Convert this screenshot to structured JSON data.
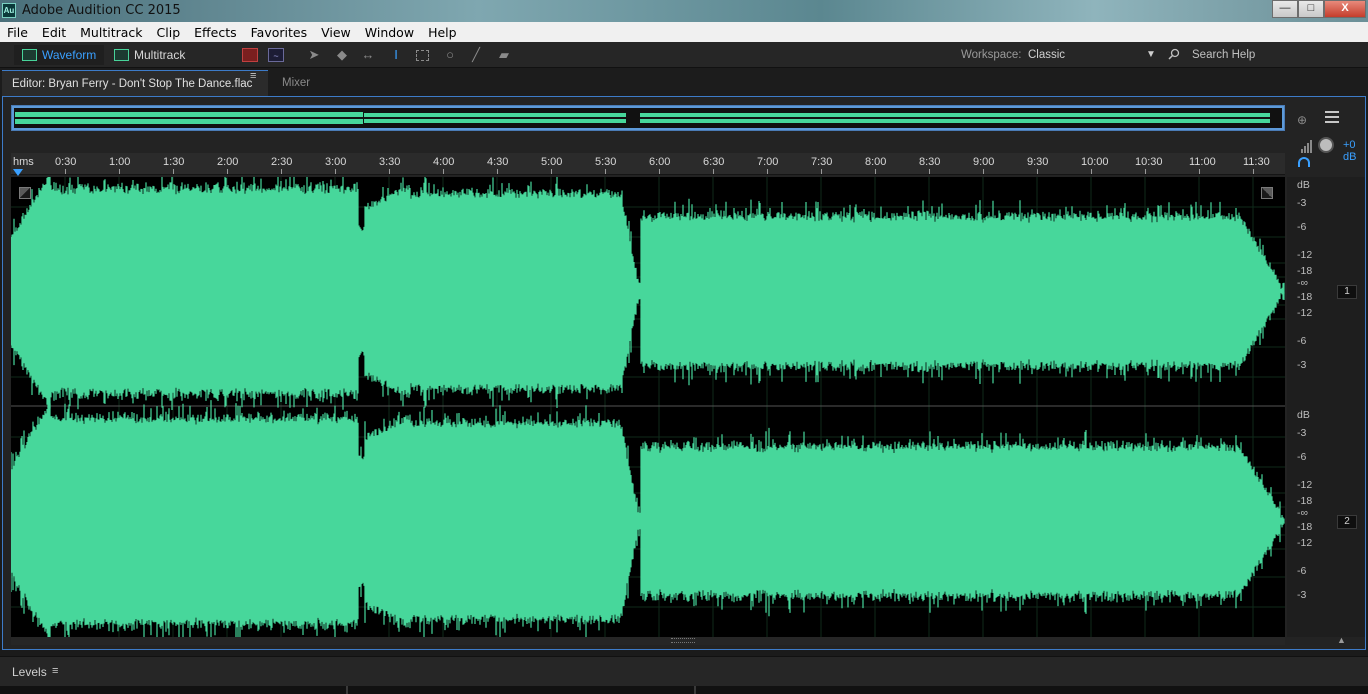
{
  "window": {
    "title": "Adobe Audition CC 2015",
    "app_icon_text": "Au",
    "buttons": {
      "minimize": "—",
      "maximize": "□",
      "close": "X"
    }
  },
  "menu": [
    "File",
    "Edit",
    "Multitrack",
    "Clip",
    "Effects",
    "Favorites",
    "View",
    "Window",
    "Help"
  ],
  "toolbar": {
    "waveform_label": "Waveform",
    "multitrack_label": "Multitrack",
    "workspace_label": "Workspace:",
    "workspace_value": "Classic",
    "search_label": "Search Help"
  },
  "tabs": {
    "editor_label": "Editor: Bryan Ferry - Don't Stop The Dance.flac",
    "mixer_label": "Mixer"
  },
  "ruler": {
    "unit_label": "hms",
    "labels": [
      "0:30",
      "1:00",
      "1:30",
      "2:00",
      "2:30",
      "3:00",
      "3:30",
      "4:00",
      "4:30",
      "5:00",
      "5:30",
      "6:00",
      "6:30",
      "7:00",
      "7:30",
      "8:00",
      "8:30",
      "9:00",
      "9:30",
      "10:00",
      "10:30",
      "11:00",
      "11:30"
    ]
  },
  "volume": {
    "value": "+0 dB"
  },
  "db_scale": {
    "header": "dB",
    "labels": [
      "-3",
      "-6",
      "-12",
      "-18",
      "-∞",
      "-18",
      "-12",
      "-6",
      "-3"
    ]
  },
  "channels": [
    "1",
    "2"
  ],
  "levels": {
    "title": "Levels",
    "menu_icon": "≡"
  },
  "colors": {
    "waveform": "#47d79b",
    "accent": "#3aa0ff",
    "background": "#000000"
  }
}
